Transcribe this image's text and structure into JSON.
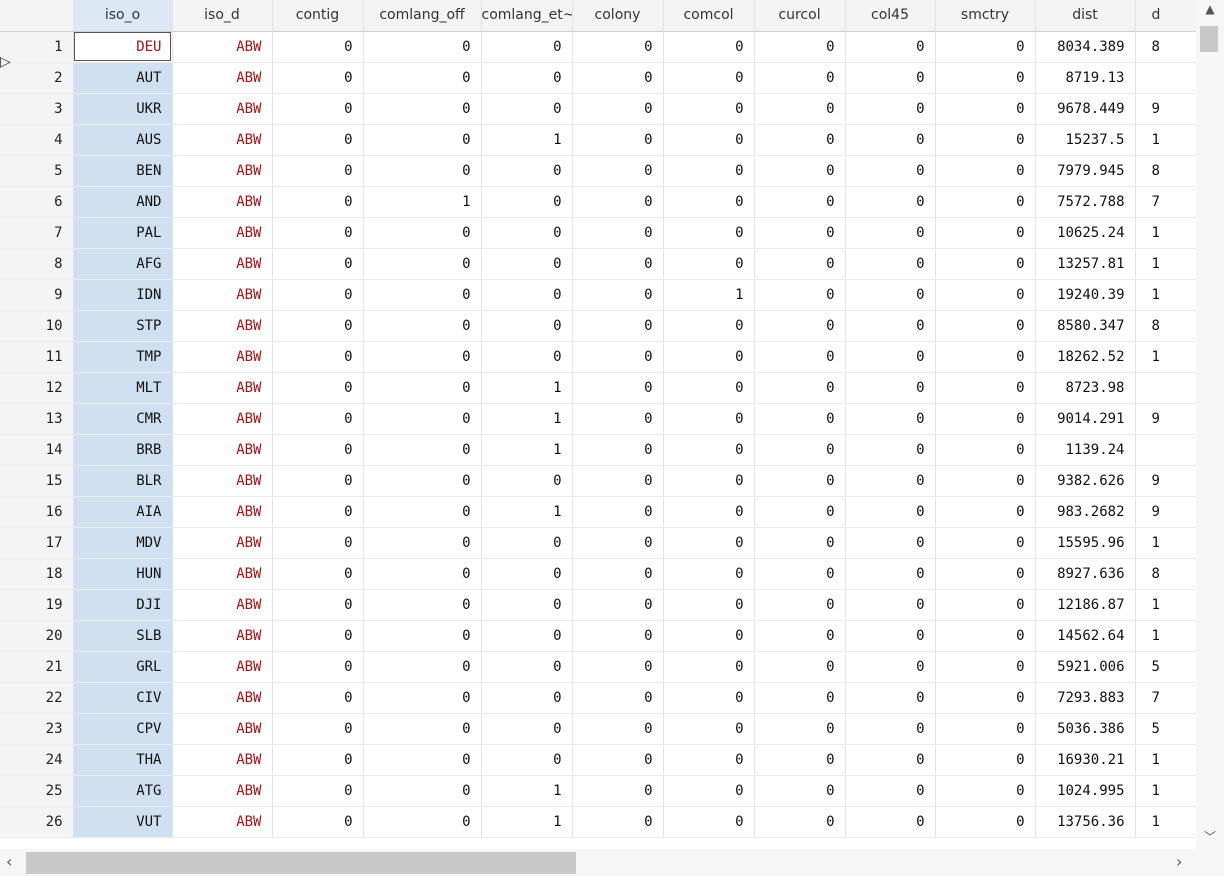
{
  "columns": [
    "iso_o",
    "iso_d",
    "contig",
    "comlang_off",
    "comlang_et~o",
    "colony",
    "comcol",
    "curcol",
    "col45",
    "smctry",
    "dist",
    "d"
  ],
  "rows": [
    {
      "n": "1",
      "iso_o": "DEU",
      "iso_d": "ABW",
      "contig": "0",
      "comlang_off": "0",
      "comlang_ethno": "0",
      "colony": "0",
      "comcol": "0",
      "curcol": "0",
      "col45": "0",
      "smctry": "0",
      "dist": "8034.389",
      "next": "8"
    },
    {
      "n": "2",
      "iso_o": "AUT",
      "iso_d": "ABW",
      "contig": "0",
      "comlang_off": "0",
      "comlang_ethno": "0",
      "colony": "0",
      "comcol": "0",
      "curcol": "0",
      "col45": "0",
      "smctry": "0",
      "dist": "8719.13",
      "next": ""
    },
    {
      "n": "3",
      "iso_o": "UKR",
      "iso_d": "ABW",
      "contig": "0",
      "comlang_off": "0",
      "comlang_ethno": "0",
      "colony": "0",
      "comcol": "0",
      "curcol": "0",
      "col45": "0",
      "smctry": "0",
      "dist": "9678.449",
      "next": "9"
    },
    {
      "n": "4",
      "iso_o": "AUS",
      "iso_d": "ABW",
      "contig": "0",
      "comlang_off": "0",
      "comlang_ethno": "1",
      "colony": "0",
      "comcol": "0",
      "curcol": "0",
      "col45": "0",
      "smctry": "0",
      "dist": "15237.5",
      "next": "1"
    },
    {
      "n": "5",
      "iso_o": "BEN",
      "iso_d": "ABW",
      "contig": "0",
      "comlang_off": "0",
      "comlang_ethno": "0",
      "colony": "0",
      "comcol": "0",
      "curcol": "0",
      "col45": "0",
      "smctry": "0",
      "dist": "7979.945",
      "next": "8"
    },
    {
      "n": "6",
      "iso_o": "AND",
      "iso_d": "ABW",
      "contig": "0",
      "comlang_off": "1",
      "comlang_ethno": "0",
      "colony": "0",
      "comcol": "0",
      "curcol": "0",
      "col45": "0",
      "smctry": "0",
      "dist": "7572.788",
      "next": "7"
    },
    {
      "n": "7",
      "iso_o": "PAL",
      "iso_d": "ABW",
      "contig": "0",
      "comlang_off": "0",
      "comlang_ethno": "0",
      "colony": "0",
      "comcol": "0",
      "curcol": "0",
      "col45": "0",
      "smctry": "0",
      "dist": "10625.24",
      "next": "1"
    },
    {
      "n": "8",
      "iso_o": "AFG",
      "iso_d": "ABW",
      "contig": "0",
      "comlang_off": "0",
      "comlang_ethno": "0",
      "colony": "0",
      "comcol": "0",
      "curcol": "0",
      "col45": "0",
      "smctry": "0",
      "dist": "13257.81",
      "next": "1"
    },
    {
      "n": "9",
      "iso_o": "IDN",
      "iso_d": "ABW",
      "contig": "0",
      "comlang_off": "0",
      "comlang_ethno": "0",
      "colony": "0",
      "comcol": "1",
      "curcol": "0",
      "col45": "0",
      "smctry": "0",
      "dist": "19240.39",
      "next": "1"
    },
    {
      "n": "10",
      "iso_o": "STP",
      "iso_d": "ABW",
      "contig": "0",
      "comlang_off": "0",
      "comlang_ethno": "0",
      "colony": "0",
      "comcol": "0",
      "curcol": "0",
      "col45": "0",
      "smctry": "0",
      "dist": "8580.347",
      "next": "8"
    },
    {
      "n": "11",
      "iso_o": "TMP",
      "iso_d": "ABW",
      "contig": "0",
      "comlang_off": "0",
      "comlang_ethno": "0",
      "colony": "0",
      "comcol": "0",
      "curcol": "0",
      "col45": "0",
      "smctry": "0",
      "dist": "18262.52",
      "next": "1"
    },
    {
      "n": "12",
      "iso_o": "MLT",
      "iso_d": "ABW",
      "contig": "0",
      "comlang_off": "0",
      "comlang_ethno": "1",
      "colony": "0",
      "comcol": "0",
      "curcol": "0",
      "col45": "0",
      "smctry": "0",
      "dist": "8723.98",
      "next": ""
    },
    {
      "n": "13",
      "iso_o": "CMR",
      "iso_d": "ABW",
      "contig": "0",
      "comlang_off": "0",
      "comlang_ethno": "1",
      "colony": "0",
      "comcol": "0",
      "curcol": "0",
      "col45": "0",
      "smctry": "0",
      "dist": "9014.291",
      "next": "9"
    },
    {
      "n": "14",
      "iso_o": "BRB",
      "iso_d": "ABW",
      "contig": "0",
      "comlang_off": "0",
      "comlang_ethno": "1",
      "colony": "0",
      "comcol": "0",
      "curcol": "0",
      "col45": "0",
      "smctry": "0",
      "dist": "1139.24",
      "next": ""
    },
    {
      "n": "15",
      "iso_o": "BLR",
      "iso_d": "ABW",
      "contig": "0",
      "comlang_off": "0",
      "comlang_ethno": "0",
      "colony": "0",
      "comcol": "0",
      "curcol": "0",
      "col45": "0",
      "smctry": "0",
      "dist": "9382.626",
      "next": "9"
    },
    {
      "n": "16",
      "iso_o": "AIA",
      "iso_d": "ABW",
      "contig": "0",
      "comlang_off": "0",
      "comlang_ethno": "1",
      "colony": "0",
      "comcol": "0",
      "curcol": "0",
      "col45": "0",
      "smctry": "0",
      "dist": "983.2682",
      "next": "9"
    },
    {
      "n": "17",
      "iso_o": "MDV",
      "iso_d": "ABW",
      "contig": "0",
      "comlang_off": "0",
      "comlang_ethno": "0",
      "colony": "0",
      "comcol": "0",
      "curcol": "0",
      "col45": "0",
      "smctry": "0",
      "dist": "15595.96",
      "next": "1"
    },
    {
      "n": "18",
      "iso_o": "HUN",
      "iso_d": "ABW",
      "contig": "0",
      "comlang_off": "0",
      "comlang_ethno": "0",
      "colony": "0",
      "comcol": "0",
      "curcol": "0",
      "col45": "0",
      "smctry": "0",
      "dist": "8927.636",
      "next": "8"
    },
    {
      "n": "19",
      "iso_o": "DJI",
      "iso_d": "ABW",
      "contig": "0",
      "comlang_off": "0",
      "comlang_ethno": "0",
      "colony": "0",
      "comcol": "0",
      "curcol": "0",
      "col45": "0",
      "smctry": "0",
      "dist": "12186.87",
      "next": "1"
    },
    {
      "n": "20",
      "iso_o": "SLB",
      "iso_d": "ABW",
      "contig": "0",
      "comlang_off": "0",
      "comlang_ethno": "0",
      "colony": "0",
      "comcol": "0",
      "curcol": "0",
      "col45": "0",
      "smctry": "0",
      "dist": "14562.64",
      "next": "1"
    },
    {
      "n": "21",
      "iso_o": "GRL",
      "iso_d": "ABW",
      "contig": "0",
      "comlang_off": "0",
      "comlang_ethno": "0",
      "colony": "0",
      "comcol": "0",
      "curcol": "0",
      "col45": "0",
      "smctry": "0",
      "dist": "5921.006",
      "next": "5"
    },
    {
      "n": "22",
      "iso_o": "CIV",
      "iso_d": "ABW",
      "contig": "0",
      "comlang_off": "0",
      "comlang_ethno": "0",
      "colony": "0",
      "comcol": "0",
      "curcol": "0",
      "col45": "0",
      "smctry": "0",
      "dist": "7293.883",
      "next": "7"
    },
    {
      "n": "23",
      "iso_o": "CPV",
      "iso_d": "ABW",
      "contig": "0",
      "comlang_off": "0",
      "comlang_ethno": "0",
      "colony": "0",
      "comcol": "0",
      "curcol": "0",
      "col45": "0",
      "smctry": "0",
      "dist": "5036.386",
      "next": "5"
    },
    {
      "n": "24",
      "iso_o": "THA",
      "iso_d": "ABW",
      "contig": "0",
      "comlang_off": "0",
      "comlang_ethno": "0",
      "colony": "0",
      "comcol": "0",
      "curcol": "0",
      "col45": "0",
      "smctry": "0",
      "dist": "16930.21",
      "next": "1"
    },
    {
      "n": "25",
      "iso_o": "ATG",
      "iso_d": "ABW",
      "contig": "0",
      "comlang_off": "0",
      "comlang_ethno": "1",
      "colony": "0",
      "comcol": "0",
      "curcol": "0",
      "col45": "0",
      "smctry": "0",
      "dist": "1024.995",
      "next": "1"
    },
    {
      "n": "26",
      "iso_o": "VUT",
      "iso_d": "ABW",
      "contig": "0",
      "comlang_off": "0",
      "comlang_ethno": "1",
      "colony": "0",
      "comcol": "0",
      "curcol": "0",
      "col45": "0",
      "smctry": "0",
      "dist": "13756.36",
      "next": "1"
    }
  ],
  "icons": {
    "up": "triangle-up-icon",
    "down": "chevron-down-icon",
    "left": "chevron-left-icon",
    "right": "chevron-right-icon",
    "cursor": "cursor-arrow-icon"
  },
  "colors": {
    "string_text": "#a31515",
    "selected_column": "#cfe0f0",
    "header_bg": "#f4f4f4"
  }
}
